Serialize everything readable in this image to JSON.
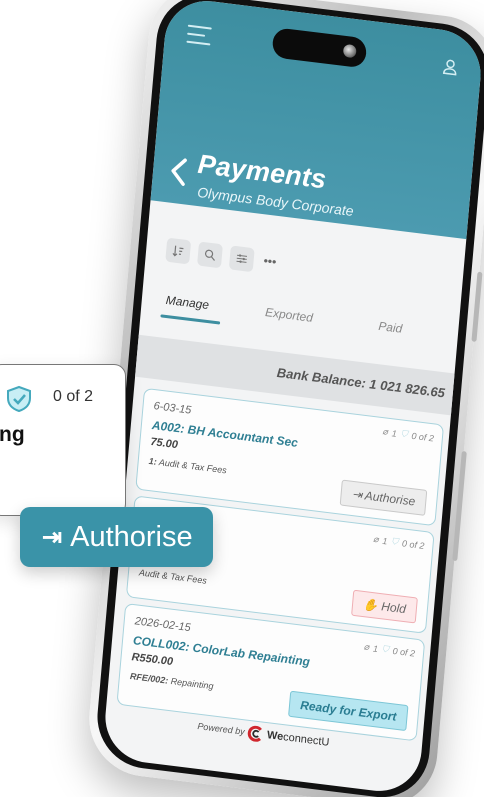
{
  "header": {
    "title": "Payments",
    "subtitle": "Olympus Body Corporate",
    "color": "#3d8ea0"
  },
  "toolbar": {
    "more_label": "•••"
  },
  "tabs": [
    {
      "label": "Manage",
      "active": true
    },
    {
      "label": "Exported",
      "active": false
    },
    {
      "label": "Paid",
      "active": false
    }
  ],
  "bank_balance": "Bank Balance: 1 021 826.65",
  "payments": [
    {
      "date": "6-03-15",
      "reference": "A002: BH Accountant Sec",
      "amount": "75.00",
      "account_code": "1:",
      "account_name": " Audit & Tax Fees",
      "attachments": "1",
      "approvals": "0 of 2",
      "action": "Authorise"
    },
    {
      "date": "",
      "reference": "",
      "amount": "",
      "account_code": "",
      "account_name": "Audit & Tax Fees",
      "attachments": "1",
      "approvals": "0 of 2",
      "action": "Hold"
    },
    {
      "date": "2026-02-15",
      "reference": "COLL002: ColorLab Repainting",
      "amount": "R550.00",
      "account_code": "RFE/002:",
      "account_name": " Repainting",
      "attachments": "1",
      "approvals": "0 of 2",
      "action": "Ready for Export"
    }
  ],
  "footer": {
    "powered_by": "Powered by",
    "brand_we": "We",
    "brand_rest": "connectU"
  },
  "callout": {
    "approvals": "0 of 2",
    "fragment": "ng",
    "action": "Authorise"
  }
}
